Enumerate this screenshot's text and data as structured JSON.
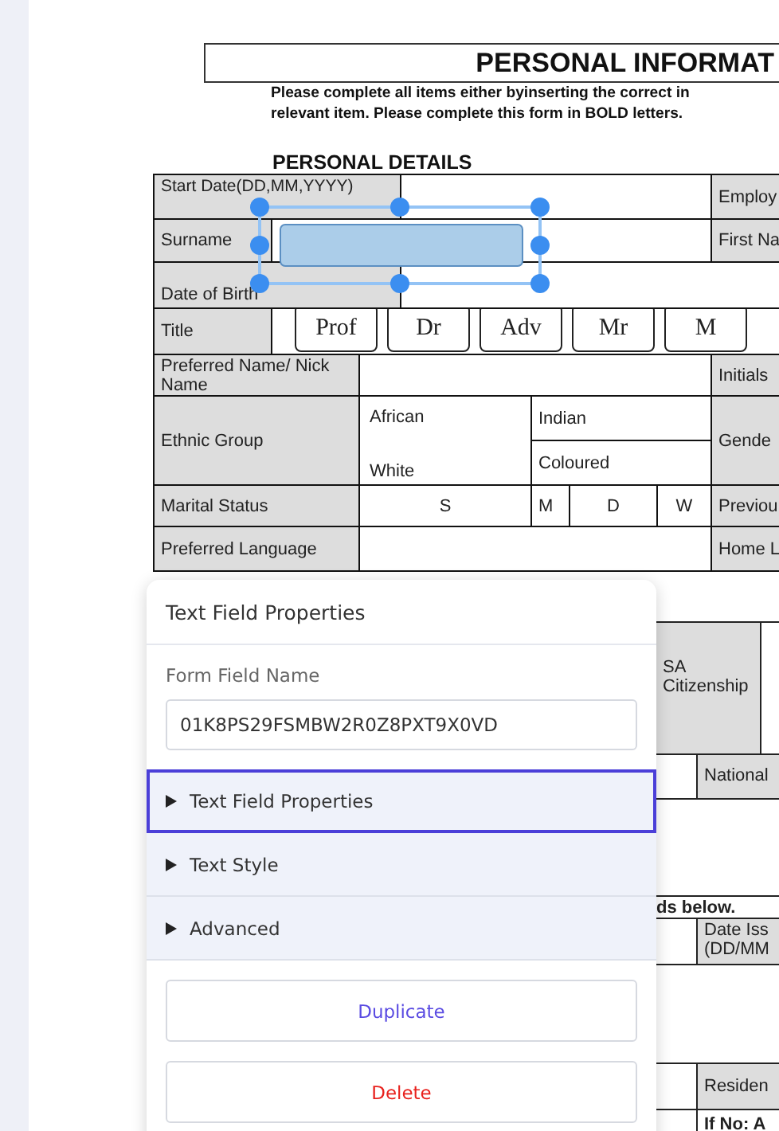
{
  "document": {
    "title": "PERSONAL INFORMAT",
    "instructions": [
      "Please complete all items either byinserting the correct in",
      "relevant item. Please complete this form in BOLD letters."
    ],
    "section_heading": "PERSONAL DETAILS",
    "table": {
      "start_date": "Start Date(DD,MM,YYYY)",
      "employ": "Employ",
      "surname": "Surname",
      "first_name": "First Na",
      "date_of_birth": "Date of Birth",
      "title": "Title",
      "title_options": [
        "Prof",
        "Dr",
        "Adv",
        "Mr",
        "M"
      ],
      "preferred_name": "Preferred Name/ Nick Name",
      "initials": "Initials",
      "ethnic_group": "Ethnic Group",
      "ethnic_options": [
        "African",
        "Indian",
        "White",
        "Coloured"
      ],
      "gender": "Gende",
      "marital_status": "Marital Status",
      "marital_options": [
        "S",
        "M",
        "D",
        "W"
      ],
      "previous": "Previou",
      "preferred_language": "Preferred Language",
      "home_language": "Home L"
    },
    "lower": {
      "sa_citizenship": "SA Citizenship",
      "national": "National",
      "notice": "ds below.",
      "date_issued": "Date Iss (DD/MM",
      "residence": "Residen",
      "if_no": "If No: A"
    }
  },
  "panel": {
    "title": "Text Field Properties",
    "field_label": "Form Field Name",
    "field_value": "01K8PS29FSMBW2R0Z8PXT9X0VD",
    "sections": [
      {
        "label": "Text Field Properties",
        "selected": true,
        "expanded": false
      },
      {
        "label": "Text Style",
        "selected": false,
        "expanded": false
      },
      {
        "label": "Advanced",
        "selected": false,
        "expanded": false
      }
    ],
    "buttons": [
      {
        "label": "Duplicate",
        "kind": "primary"
      },
      {
        "label": "Delete",
        "kind": "danger"
      }
    ]
  }
}
